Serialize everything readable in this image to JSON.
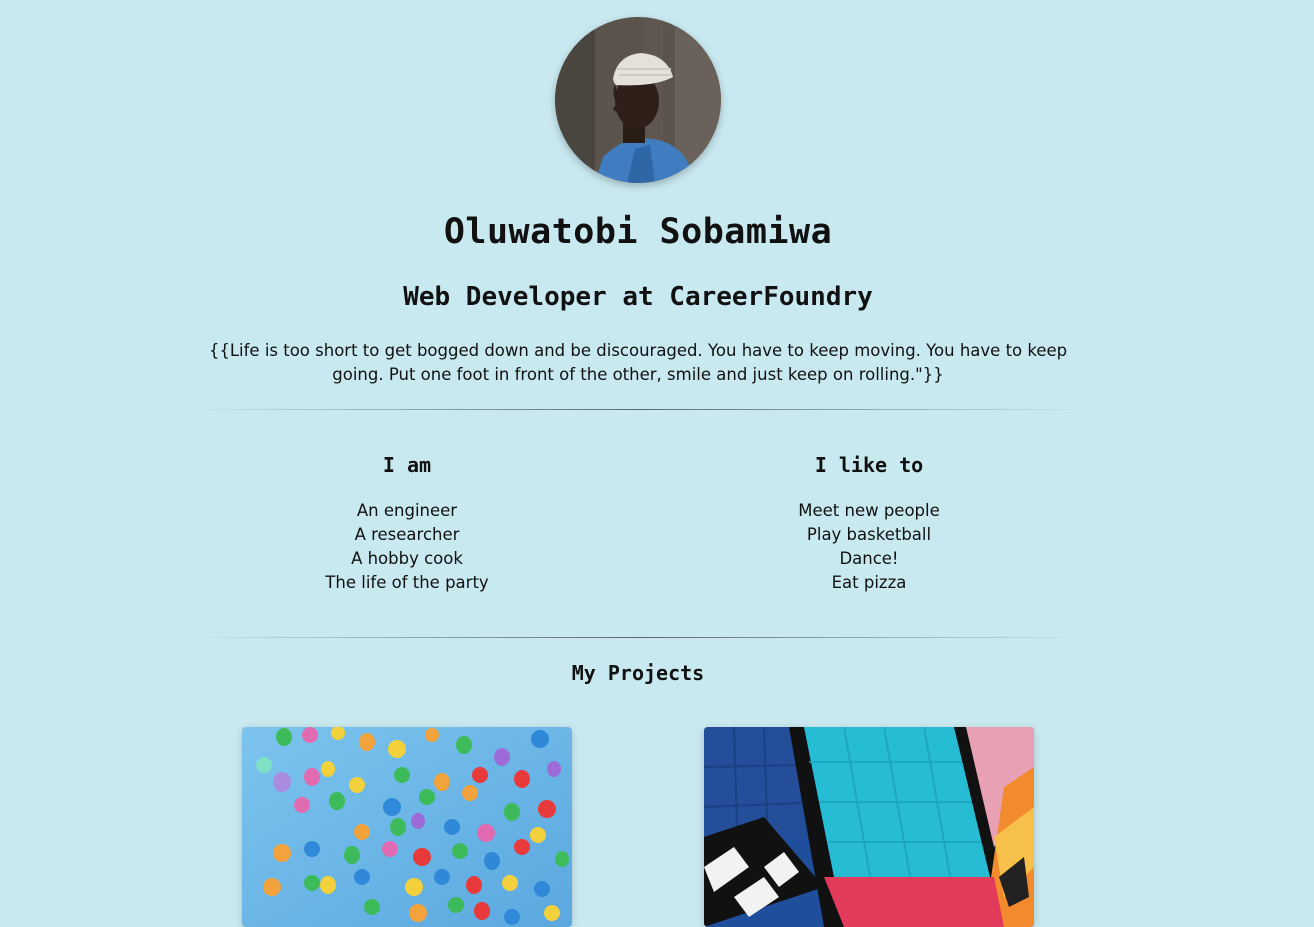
{
  "profile": {
    "name": "Oluwatobi Sobamiwa",
    "role": "Web Developer at CareerFoundry",
    "quote": "{{Life is too short to get bogged down and be discouraged. You have to keep moving. You have to keep going. Put one foot in front of the other, smile and just keep on rolling.\"}}"
  },
  "about": {
    "i_am": {
      "heading": "I am",
      "items": [
        "An engineer",
        "A researcher",
        "A hobby cook",
        "The life of the party"
      ]
    },
    "i_like": {
      "heading": "I like to",
      "items": [
        "Meet new people",
        "Play basketball",
        "Dance!",
        "Eat pizza"
      ]
    }
  },
  "projects": {
    "title": "My Projects",
    "cards": [
      {
        "image": "colorful-balloons"
      },
      {
        "image": "colorful-graffiti-wall"
      }
    ]
  },
  "colors": {
    "background": "#c9e9f0",
    "text": "#111111"
  }
}
